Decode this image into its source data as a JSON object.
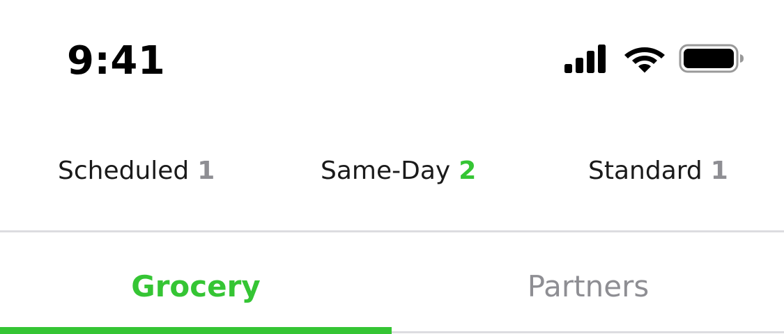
{
  "status_bar": {
    "time": "9:41",
    "icons": [
      "cellular-signal-icon",
      "wifi-icon",
      "battery-icon"
    ]
  },
  "delivery_types": [
    {
      "label": "Scheduled",
      "count": "1",
      "count_color": "#8e8e93"
    },
    {
      "label": "Same-Day",
      "count": "2",
      "count_color": "#35c534"
    },
    {
      "label": "Standard",
      "count": "1",
      "count_color": "#8e8e93"
    }
  ],
  "tabs": [
    {
      "label": "Grocery",
      "active": true
    },
    {
      "label": "Partners",
      "active": false
    }
  ],
  "colors": {
    "accent": "#35c534",
    "muted": "#8e8e93",
    "text": "#1a1a1a",
    "divider": "#dcdce0"
  }
}
